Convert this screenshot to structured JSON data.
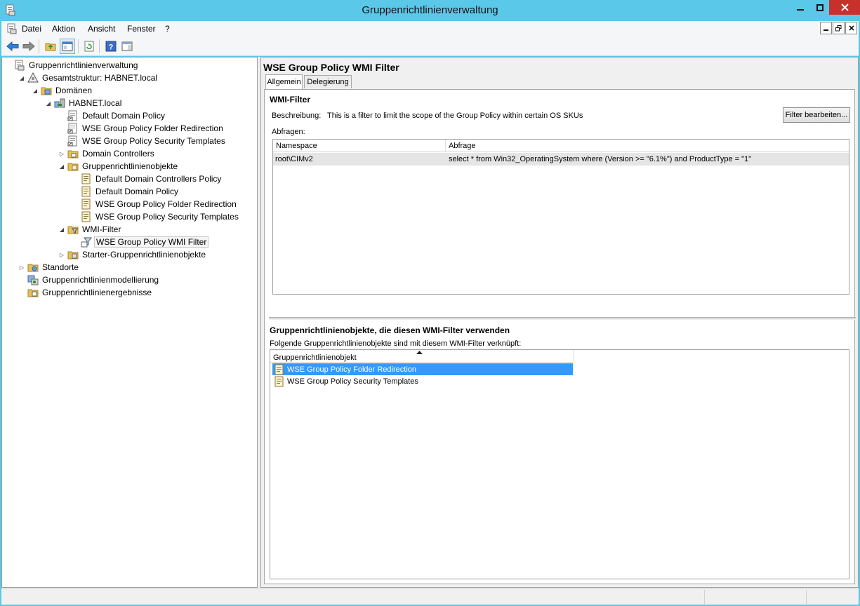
{
  "window": {
    "title": "Gruppenrichtlinienverwaltung",
    "accent_color": "#5ac8e8",
    "close_color": "#c7312b"
  },
  "menubar": {
    "items": [
      "Datei",
      "Aktion",
      "Ansicht",
      "Fenster",
      "?"
    ]
  },
  "toolbar": {
    "icons": [
      "back-arrow-icon",
      "forward-arrow-icon",
      "up-folder-icon",
      "show-hide-console-tree-icon",
      "refresh-icon",
      "help-icon",
      "action-pane-icon"
    ]
  },
  "tree": {
    "items": [
      {
        "label": "Gruppenrichtlinienverwaltung",
        "level": 0,
        "toggle": "",
        "icon": "gpmc-icon"
      },
      {
        "label": "Gesamtstruktur: HABNET.local",
        "level": 1,
        "toggle": "expanded",
        "icon": "forest-icon"
      },
      {
        "label": "Domänen",
        "level": 2,
        "toggle": "expanded",
        "icon": "domains-folder-icon"
      },
      {
        "label": "HABNET.local",
        "level": 3,
        "toggle": "expanded",
        "icon": "domain-icon"
      },
      {
        "label": "Default Domain Policy",
        "level": 4,
        "toggle": "",
        "icon": "gpo-link-icon"
      },
      {
        "label": "WSE Group Policy Folder Redirection",
        "level": 4,
        "toggle": "",
        "icon": "gpo-link-icon"
      },
      {
        "label": "WSE Group Policy Security Templates",
        "level": 4,
        "toggle": "",
        "icon": "gpo-link-icon"
      },
      {
        "label": "Domain Controllers",
        "level": 4,
        "toggle": "collapsed",
        "icon": "ou-folder-icon"
      },
      {
        "label": "Gruppenrichtlinienobjekte",
        "level": 4,
        "toggle": "expanded",
        "icon": "gpo-folder-icon"
      },
      {
        "label": "Default Domain Controllers Policy",
        "level": 5,
        "toggle": "",
        "icon": "gpo-icon"
      },
      {
        "label": "Default Domain Policy",
        "level": 5,
        "toggle": "",
        "icon": "gpo-icon"
      },
      {
        "label": "WSE Group Policy Folder Redirection",
        "level": 5,
        "toggle": "",
        "icon": "gpo-icon"
      },
      {
        "label": "WSE Group Policy Security Templates",
        "level": 5,
        "toggle": "",
        "icon": "gpo-icon"
      },
      {
        "label": "WMI-Filter",
        "level": 4,
        "toggle": "expanded",
        "icon": "wmi-folder-icon"
      },
      {
        "label": "WSE Group Policy WMI Filter",
        "level": 5,
        "toggle": "",
        "icon": "wmi-filter-icon",
        "selected": true
      },
      {
        "label": "Starter-Gruppenrichtlinienobjekte",
        "level": 4,
        "toggle": "collapsed",
        "icon": "starter-gpo-folder-icon"
      },
      {
        "label": "Standorte",
        "level": 1,
        "toggle": "collapsed",
        "icon": "sites-folder-icon"
      },
      {
        "label": "Gruppenrichtlinienmodellierung",
        "level": 1,
        "toggle": "",
        "icon": "modeling-icon"
      },
      {
        "label": "Gruppenrichtlinienergebnisse",
        "level": 1,
        "toggle": "",
        "icon": "results-folder-icon"
      }
    ]
  },
  "details": {
    "title": "WSE Group Policy WMI Filter",
    "tabs": [
      "Allgemein",
      "Delegierung"
    ],
    "wmi_section": "WMI-Filter",
    "description_label": "Beschreibung:",
    "description_value": "This is a filter to limit the scope of the Group Policy within certain OS SKUs",
    "edit_button": "Filter bearbeiten...",
    "queries_label": "Abfragen:",
    "query_columns": [
      "Namespace",
      "Abfrage"
    ],
    "queries": [
      {
        "namespace": "root\\CIMv2",
        "query": "select * from Win32_OperatingSystem where (Version >= \"6.1%\") and ProductType = \"1\""
      }
    ],
    "gpo_section": "Gruppenrichtlinienobjekte, die diesen WMI-Filter verwenden",
    "gpo_subtitle": "Folgende Gruppenrichtlinienobjekte sind mit diesem WMI-Filter verknüpft:",
    "gpo_column": "Gruppenrichtlinienobjekt",
    "gpos": [
      {
        "label": "WSE Group Policy Folder Redirection",
        "selected": true
      },
      {
        "label": "WSE Group Policy Security Templates",
        "selected": false
      }
    ]
  }
}
